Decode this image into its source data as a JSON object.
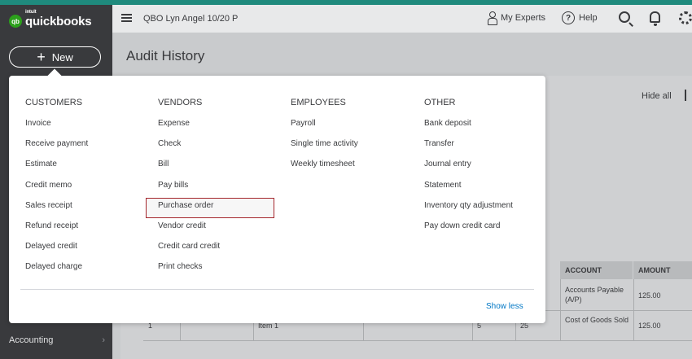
{
  "brand": {
    "intuit": "intuit",
    "name": "quickbooks",
    "mark": "qb"
  },
  "new_button": {
    "label": "New",
    "plus": "+"
  },
  "sidebar": {
    "items": [
      {
        "label": "Accounting",
        "chevron": "›"
      }
    ]
  },
  "topbar": {
    "company": "QBO Lyn Angel 10/20 P",
    "my_experts": "My Experts",
    "help": "Help",
    "help_glyph": "?"
  },
  "page": {
    "title": "Audit History",
    "hide_all": "Hide all"
  },
  "table": {
    "headers": [
      "ACCOUNT",
      "AMOUNT"
    ],
    "rows": [
      {
        "account": "Accounts Payable (A/P)",
        "amount": "125.00"
      },
      {
        "col1": "1",
        "item": "Item 1",
        "qty": "5",
        "rate": "25",
        "account": "Cost of Goods Sold",
        "amount": "125.00"
      }
    ]
  },
  "menu": {
    "columns": [
      {
        "heading": "CUSTOMERS",
        "items": [
          "Invoice",
          "Receive payment",
          "Estimate",
          "Credit memo",
          "Sales receipt",
          "Refund receipt",
          "Delayed credit",
          "Delayed charge"
        ]
      },
      {
        "heading": "VENDORS",
        "items": [
          "Expense",
          "Check",
          "Bill",
          "Pay bills",
          "Purchase order",
          "Vendor credit",
          "Credit card credit",
          "Print checks"
        ]
      },
      {
        "heading": "EMPLOYEES",
        "items": [
          "Payroll",
          "Single time activity",
          "Weekly timesheet"
        ]
      },
      {
        "heading": "OTHER",
        "items": [
          "Bank deposit",
          "Transfer",
          "Journal entry",
          "Statement",
          "Inventory qty adjustment",
          "Pay down credit card"
        ]
      }
    ],
    "selected": "Purchase order",
    "show_less": "Show less"
  },
  "colors": {
    "accent": "#2ca01c",
    "sidebar": "#393a3d",
    "link": "#0077c5",
    "selected_border": "#a4262c"
  },
  "icons": [
    "hamburger-icon",
    "person-icon",
    "help-icon",
    "search-icon",
    "bell-icon",
    "gear-icon",
    "chevron-right-icon"
  ]
}
